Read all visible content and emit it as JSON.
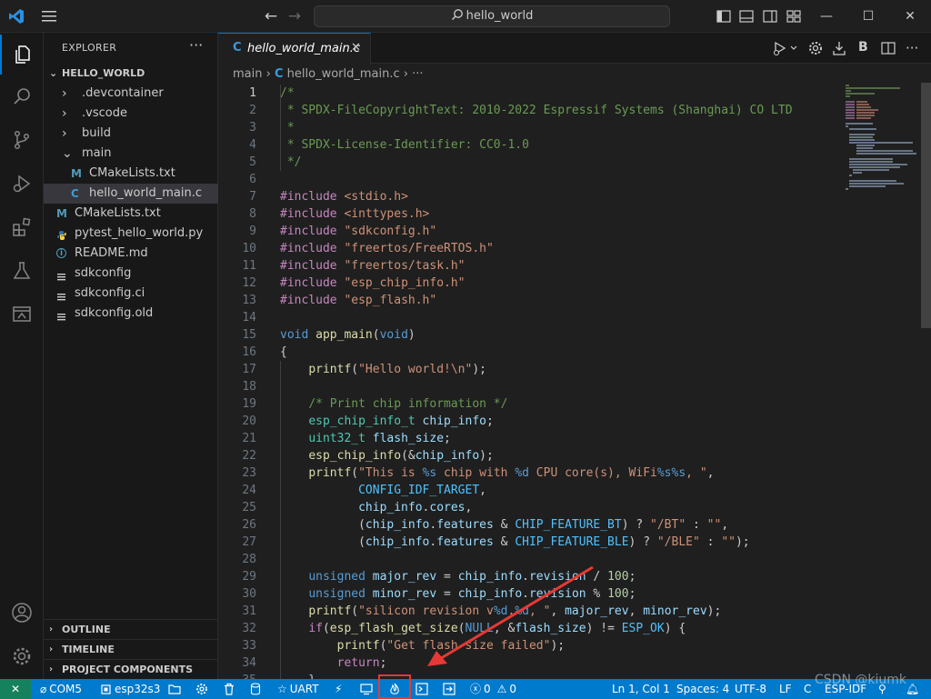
{
  "titlebar": {
    "search_text": "hello_world"
  },
  "explorer": {
    "title": "EXPLORER",
    "more": "···",
    "root": "HELLO_WORLD",
    "items": [
      {
        "label": ".devcontainer",
        "kind": "folder-collapsed"
      },
      {
        "label": ".vscode",
        "kind": "folder-collapsed"
      },
      {
        "label": "build",
        "kind": "folder-collapsed"
      },
      {
        "label": "main",
        "kind": "folder-expanded"
      },
      {
        "label": "CMakeLists.txt",
        "kind": "cmake",
        "icon_text": "M"
      },
      {
        "label": "hello_world_main.c",
        "kind": "c",
        "icon_text": "C",
        "selected": true
      },
      {
        "label": "CMakeLists.txt",
        "kind": "cmake",
        "icon_text": "M"
      },
      {
        "label": "pytest_hello_world.py",
        "kind": "python"
      },
      {
        "label": "README.md",
        "kind": "info",
        "icon_text": "i"
      },
      {
        "label": "sdkconfig",
        "kind": "lines"
      },
      {
        "label": "sdkconfig.ci",
        "kind": "lines"
      },
      {
        "label": "sdkconfig.old",
        "kind": "lines"
      }
    ],
    "sections": [
      "OUTLINE",
      "TIMELINE",
      "PROJECT COMPONENTS"
    ]
  },
  "editor": {
    "tab_icon": "C",
    "tab_label": "hello_world_main.c",
    "tab_close": "✕",
    "breadcrumb": {
      "folder": "main",
      "sep": "›",
      "file_icon": "C",
      "file": "hello_world_main.c",
      "more": "›  ···"
    },
    "action_b": "B",
    "code_lines": [
      {
        "n": "1",
        "html": "<span class=\"cm\">/*</span>"
      },
      {
        "n": "2",
        "html": "<span class=\"cm\"> * SPDX-FileCopyrightText: 2010-2022 Espressif Systems (Shanghai) CO LTD</span>"
      },
      {
        "n": "3",
        "html": "<span class=\"cm\"> *</span>"
      },
      {
        "n": "4",
        "html": "<span class=\"cm\"> * SPDX-License-Identifier: CC0-1.0</span>"
      },
      {
        "n": "5",
        "html": "<span class=\"cm\"> */</span>"
      },
      {
        "n": "6",
        "html": ""
      },
      {
        "n": "7",
        "html": "<span class=\"kw\">#include</span> <span class=\"st\">&lt;stdio.h&gt;</span>"
      },
      {
        "n": "8",
        "html": "<span class=\"kw\">#include</span> <span class=\"st\">&lt;inttypes.h&gt;</span>"
      },
      {
        "n": "9",
        "html": "<span class=\"kw\">#include</span> <span class=\"st\">\"sdkconfig.h\"</span>"
      },
      {
        "n": "10",
        "html": "<span class=\"kw\">#include</span> <span class=\"st\">\"freertos/FreeRTOS.h\"</span>"
      },
      {
        "n": "11",
        "html": "<span class=\"kw\">#include</span> <span class=\"st\">\"freertos/task.h\"</span>"
      },
      {
        "n": "12",
        "html": "<span class=\"kw\">#include</span> <span class=\"st\">\"esp_chip_info.h\"</span>"
      },
      {
        "n": "13",
        "html": "<span class=\"kw\">#include</span> <span class=\"st\">\"esp_flash.h\"</span>"
      },
      {
        "n": "14",
        "html": ""
      },
      {
        "n": "15",
        "html": "<span class=\"ty\">void</span> <span class=\"fn\">app_main</span>(<span class=\"ty\">void</span>)"
      },
      {
        "n": "16",
        "html": "{"
      },
      {
        "n": "17",
        "html": "    <span class=\"fn\">printf</span>(<span class=\"st\">\"Hello world!\\n\"</span>);"
      },
      {
        "n": "18",
        "html": ""
      },
      {
        "n": "19",
        "html": "    <span class=\"cm\">/* Print chip information */</span>"
      },
      {
        "n": "20",
        "html": "    <span class=\"tp\">esp_chip_info_t</span> <span class=\"vr\">chip_info</span>;"
      },
      {
        "n": "21",
        "html": "    <span class=\"tp\">uint32_t</span> <span class=\"vr\">flash_size</span>;"
      },
      {
        "n": "22",
        "html": "    <span class=\"fn\">esp_chip_info</span>(&amp;<span class=\"vr\">chip_info</span>);"
      },
      {
        "n": "23",
        "html": "    <span class=\"fn\">printf</span>(<span class=\"st\">\"This is <span class=\"fm\">%s</span> chip with <span class=\"fm\">%d</span> CPU core(s), WiFi<span class=\"fm\">%s%s</span>, \"</span>,"
      },
      {
        "n": "24",
        "html": "           <span class=\"mc\">CONFIG_IDF_TARGET</span>,"
      },
      {
        "n": "25",
        "html": "           <span class=\"vr\">chip_info</span>.<span class=\"vr\">cores</span>,"
      },
      {
        "n": "26",
        "html": "           (<span class=\"vr\">chip_info</span>.<span class=\"vr\">features</span> &amp; <span class=\"mc\">CHIP_FEATURE_BT</span>) ? <span class=\"st\">\"/BT\"</span> : <span class=\"st\">\"\"</span>,"
      },
      {
        "n": "27",
        "html": "           (<span class=\"vr\">chip_info</span>.<span class=\"vr\">features</span> &amp; <span class=\"mc\">CHIP_FEATURE_BLE</span>) ? <span class=\"st\">\"/BLE\"</span> : <span class=\"st\">\"\"</span>);"
      },
      {
        "n": "28",
        "html": ""
      },
      {
        "n": "29",
        "html": "    <span class=\"ty\">unsigned</span> <span class=\"vr\">major_rev</span> = <span class=\"vr\">chip_info</span>.<span class=\"vr\">revision</span> / <span class=\"nu\">100</span>;"
      },
      {
        "n": "30",
        "html": "    <span class=\"ty\">unsigned</span> <span class=\"vr\">minor_rev</span> = <span class=\"vr\">chip_info</span>.<span class=\"vr\">revision</span> % <span class=\"nu\">100</span>;"
      },
      {
        "n": "31",
        "html": "    <span class=\"fn\">printf</span>(<span class=\"st\">\"silicon revision v<span class=\"fm\">%d</span>.<span class=\"fm\">%d</span>, \"</span>, <span class=\"vr\">major_rev</span>, <span class=\"vr\">minor_rev</span>);"
      },
      {
        "n": "32",
        "html": "    <span class=\"kw\">if</span>(<span class=\"fn\">esp_flash_get_size</span>(<span class=\"ty\">NULL</span>, &amp;<span class=\"vr\">flash_size</span>) != <span class=\"mc\">ESP_OK</span>) {"
      },
      {
        "n": "33",
        "html": "        <span class=\"fn\">printf</span>(<span class=\"st\">\"Get flash size failed\"</span>);"
      },
      {
        "n": "34",
        "html": "        <span class=\"kw\">return</span>;"
      },
      {
        "n": "35",
        "html": "    }"
      }
    ]
  },
  "statusbar": {
    "remote": "✕",
    "port": "COM5",
    "target": "esp32s3",
    "uart": "UART",
    "errors": "0",
    "warnings": "0",
    "position": "Ln 1, Col 1",
    "spaces": "Spaces: 4",
    "encoding": "UTF-8",
    "eol": "LF",
    "language": "C",
    "idf": "ESP-IDF"
  },
  "watermark": "CSDN @kiumk",
  "colors": {
    "accent": "#0078d4",
    "statusbar": "#007acc",
    "remote": "#16825d",
    "highlight": "#e53935",
    "arrow": "#e53935"
  }
}
